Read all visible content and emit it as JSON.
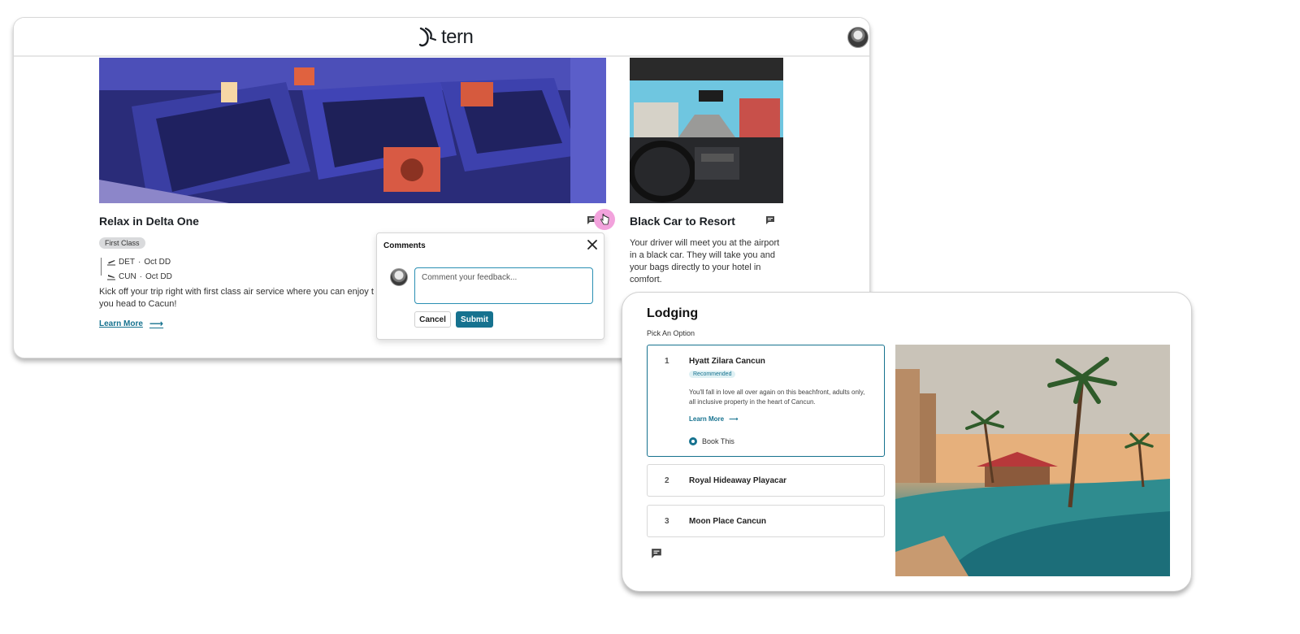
{
  "header": {
    "brand": "tern"
  },
  "cards": [
    {
      "title": "Relax in Delta One",
      "tag": "First Class",
      "route": [
        {
          "code": "DET",
          "date": "Oct DD"
        },
        {
          "code": "CUN",
          "date": "Oct DD"
        }
      ],
      "separator": "·",
      "description": "Kick off your trip right with first class air service where you can enjoy t",
      "description_cont": "you head to Cacun!",
      "learn_more": "Learn More"
    },
    {
      "title": "Black Car to Resort",
      "description": "Your driver will meet you at the airport in a black car. They will take you and your bags directly to your hotel in comfort."
    }
  ],
  "comments_popover": {
    "title": "Comments",
    "placeholder": "Comment your feedback...",
    "cancel_label": "Cancel",
    "submit_label": "Submit"
  },
  "lodging": {
    "title": "Lodging",
    "subtitle": "Pick An Option",
    "options": [
      {
        "number": "1",
        "name": "Hyatt Zilara Cancun",
        "badge": "Recommended",
        "description": "You'll fall in love all over again on this beachfront, adults only, all inclusive property in the heart of Cancun.",
        "learn_more": "Learn More",
        "book_label": "Book This",
        "selected": true
      },
      {
        "number": "2",
        "name": "Royal Hideaway Playacar"
      },
      {
        "number": "3",
        "name": "Moon Place Cancun"
      }
    ]
  },
  "colors": {
    "accent": "#16728f",
    "cursor_highlight": "#f2a2dc",
    "tag_bg": "#d9dadc"
  },
  "icons": [
    "tern-logo-icon",
    "comment-icon",
    "close-icon",
    "takeoff-icon",
    "landing-icon",
    "arrow-right-icon",
    "hand-cursor-icon"
  ]
}
